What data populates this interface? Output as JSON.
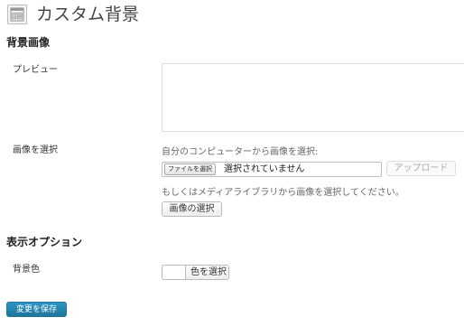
{
  "header": {
    "icon": "appearance-icon",
    "title": "カスタム背景"
  },
  "background_image_section": {
    "heading": "背景画像",
    "preview_label": "プレビュー",
    "select_image_label": "画像を選択",
    "upload_hint": "自分のコンピューターから画像を選択:",
    "file_button_label": "ファイルを選択",
    "file_status": "選択されていません",
    "upload_button_label": "アップロード",
    "library_hint": "もしくはメディアライブラリから画像を選択してください。",
    "library_button_label": "画像の選択"
  },
  "display_options_section": {
    "heading": "表示オプション",
    "bg_color_label": "背景色",
    "bg_color_value": "#ffffff",
    "select_color_button_label": "色を選択"
  },
  "footer": {
    "save_button_label": "変更を保存"
  },
  "colors": {
    "primary": "#21759b",
    "primary_light": "#2a95c5"
  }
}
